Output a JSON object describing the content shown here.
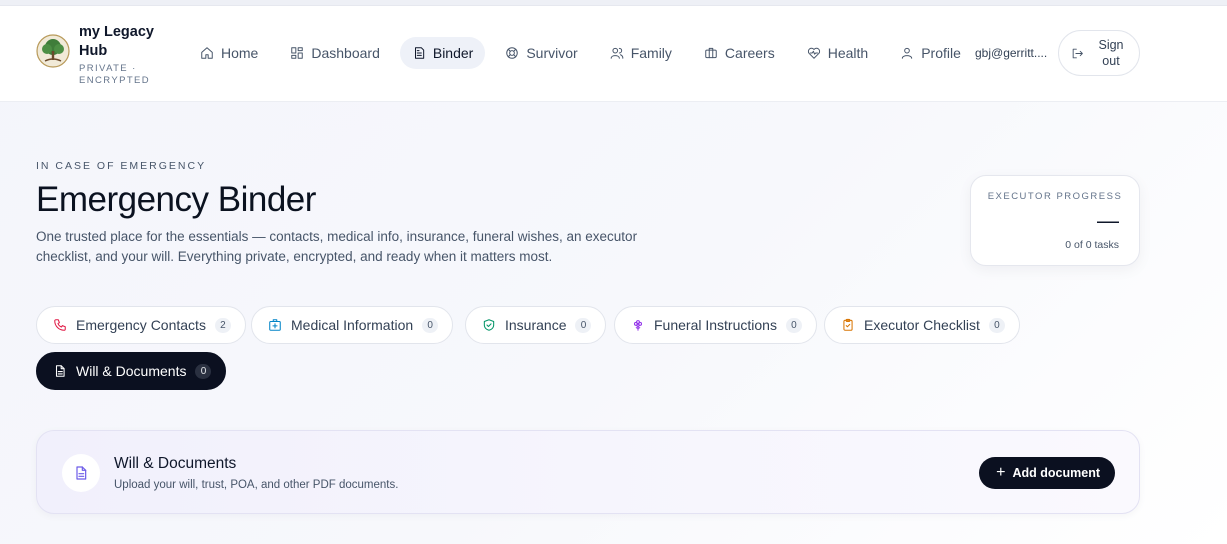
{
  "brand": {
    "name": "my Legacy Hub",
    "subtitle": "PRIVATE · ENCRYPTED"
  },
  "nav": {
    "items": [
      {
        "label": "Home",
        "icon": "home-icon",
        "active": false
      },
      {
        "label": "Dashboard",
        "icon": "dashboard-icon",
        "active": false
      },
      {
        "label": "Binder",
        "icon": "binder-icon",
        "active": true
      },
      {
        "label": "Survivor",
        "icon": "lifebuoy-icon",
        "active": false
      },
      {
        "label": "Family",
        "icon": "family-icon",
        "active": false
      },
      {
        "label": "Careers",
        "icon": "briefcase-icon",
        "active": false
      },
      {
        "label": "Health",
        "icon": "heart-pulse-icon",
        "active": false
      },
      {
        "label": "Profile",
        "icon": "user-icon",
        "active": false
      }
    ],
    "user_email": "gbj@gerritt....",
    "sign_out_label": "Sign out"
  },
  "header": {
    "eyebrow": "IN CASE OF EMERGENCY",
    "title": "Emergency Binder",
    "description": "One trusted place for the essentials — contacts, medical info, insurance, funeral wishes, an executor checklist, and your will. Everything private, encrypted, and ready when it matters most."
  },
  "executor_progress": {
    "label": "EXECUTOR PROGRESS",
    "value": "—",
    "tasks": "0 of 0 tasks"
  },
  "tabs": [
    {
      "label": "Emergency Contacts",
      "count": "2",
      "icon": "phone-icon",
      "color": "#e11d48",
      "active": false
    },
    {
      "label": "Medical Information",
      "count": "0",
      "icon": "hospital-icon",
      "color": "#0284c7",
      "active": false
    },
    {
      "label": "Insurance",
      "count": "0",
      "icon": "shield-icon",
      "color": "#059669",
      "active": false
    },
    {
      "label": "Funeral Instructions",
      "count": "0",
      "icon": "flower-icon",
      "color": "#9333ea",
      "active": false
    },
    {
      "label": "Executor Checklist",
      "count": "0",
      "icon": "clipboard-icon",
      "color": "#d97706",
      "active": false
    },
    {
      "label": "Will & Documents",
      "count": "0",
      "icon": "document-icon",
      "color": "#ffffff",
      "active": true
    }
  ],
  "section": {
    "title": "Will & Documents",
    "subtitle": "Upload your will, trust, POA, and other PDF documents.",
    "add_button_label": "Add document",
    "accent": "#6d5ce8"
  }
}
